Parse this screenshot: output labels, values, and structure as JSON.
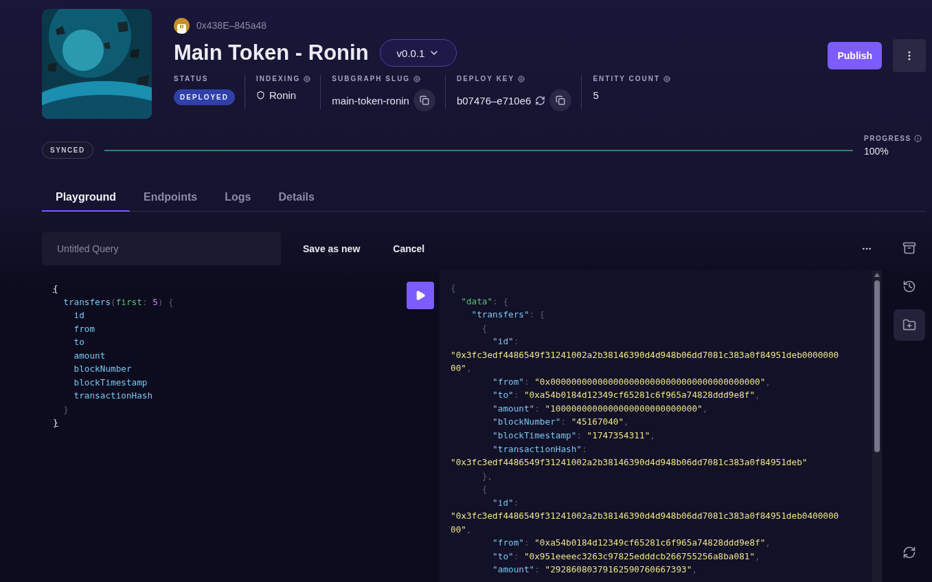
{
  "subgraph": {
    "owner": "0x438E–845a48",
    "title": "Main Token - Ronin",
    "version": "v0.0.1"
  },
  "stats": [
    {
      "kind": "badge",
      "label": "STATUS",
      "info": false,
      "value": "DEPLOYED"
    },
    {
      "kind": "network",
      "label": "INDEXING",
      "info": true,
      "value": "Ronin"
    },
    {
      "kind": "copy",
      "label": "SUBGRAPH SLUG",
      "info": true,
      "value": "main-token-ronin"
    },
    {
      "kind": "key",
      "label": "DEPLOY KEY",
      "info": true,
      "value": "b07476–e710e6"
    },
    {
      "kind": "text",
      "label": "ENTITY COUNT",
      "info": true,
      "value": "5"
    }
  ],
  "actions": {
    "publish": "Publish"
  },
  "sync": {
    "status": "SYNCED",
    "progress_label": "PROGRESS",
    "progress_value": "100%",
    "level": 1
  },
  "tabs": [
    {
      "label": "Playground",
      "selected": true
    },
    {
      "label": "Endpoints",
      "selected": false
    },
    {
      "label": "Logs",
      "selected": false
    },
    {
      "label": "Details",
      "selected": false
    }
  ],
  "query_bar": {
    "placeholder": "Untitled Query",
    "save": "Save as new",
    "cancel": "Cancel"
  },
  "query": [
    [
      {
        "kind": "match",
        "text": "{"
      }
    ],
    [
      {
        "kind": "field",
        "text": "  transfers"
      },
      {
        "kind": "punct",
        "text": "("
      },
      {
        "kind": "arg",
        "text": "first"
      },
      {
        "kind": "punct",
        "text": ": "
      },
      {
        "kind": "number",
        "text": "5"
      },
      {
        "kind": "punct",
        "text": ") {"
      }
    ],
    [
      {
        "kind": "field",
        "text": "    id"
      }
    ],
    [
      {
        "kind": "field",
        "text": "    from"
      }
    ],
    [
      {
        "kind": "field",
        "text": "    to"
      }
    ],
    [
      {
        "kind": "field",
        "text": "    amount"
      }
    ],
    [
      {
        "kind": "field",
        "text": "    blockNumber"
      }
    ],
    [
      {
        "kind": "field",
        "text": "    blockTimestamp"
      }
    ],
    [
      {
        "kind": "field",
        "text": "    transactionHash"
      }
    ],
    [
      {
        "kind": "punct",
        "text": "  }"
      }
    ],
    [
      {
        "kind": "match",
        "text": "}"
      }
    ]
  ],
  "response": [
    [
      {
        "kind": "punct",
        "text": "{"
      }
    ],
    [
      {
        "kind": "datakey",
        "text": "  \"data\""
      },
      {
        "kind": "punct",
        "text": ": {"
      }
    ],
    [
      {
        "kind": "field",
        "text": "    \"transfers\""
      },
      {
        "kind": "punct",
        "text": ": ["
      }
    ],
    [
      {
        "kind": "punct",
        "text": "      {"
      }
    ],
    [
      {
        "kind": "field",
        "text": "        \"id\""
      },
      {
        "kind": "punct",
        "text": ":"
      }
    ],
    [
      {
        "kind": "string",
        "text": "\"0x3fc3edf4486549f31241002a2b38146390d4d948b06dd7081c383a0f84951deb0000000"
      }
    ],
    [
      {
        "kind": "string",
        "text": "00\""
      },
      {
        "kind": "punct",
        "text": ","
      }
    ],
    [
      {
        "kind": "field",
        "text": "        \"from\""
      },
      {
        "kind": "punct",
        "text": ": "
      },
      {
        "kind": "string",
        "text": "\"0x0000000000000000000000000000000000000000\""
      },
      {
        "kind": "punct",
        "text": ","
      }
    ],
    [
      {
        "kind": "field",
        "text": "        \"to\""
      },
      {
        "kind": "punct",
        "text": ": "
      },
      {
        "kind": "string",
        "text": "\"0xa54b0184d12349cf65281c6f965a74828ddd9e8f\""
      },
      {
        "kind": "punct",
        "text": ","
      }
    ],
    [
      {
        "kind": "field",
        "text": "        \"amount\""
      },
      {
        "kind": "punct",
        "text": ": "
      },
      {
        "kind": "string",
        "text": "\"1000000000000000000000000000\""
      },
      {
        "kind": "punct",
        "text": ","
      }
    ],
    [
      {
        "kind": "field",
        "text": "        \"blockNumber\""
      },
      {
        "kind": "punct",
        "text": ": "
      },
      {
        "kind": "string",
        "text": "\"45167040\""
      },
      {
        "kind": "punct",
        "text": ","
      }
    ],
    [
      {
        "kind": "field",
        "text": "        \"blockTimestamp\""
      },
      {
        "kind": "punct",
        "text": ": "
      },
      {
        "kind": "string",
        "text": "\"1747354311\""
      },
      {
        "kind": "punct",
        "text": ","
      }
    ],
    [
      {
        "kind": "field",
        "text": "        \"transactionHash\""
      },
      {
        "kind": "punct",
        "text": ":"
      }
    ],
    [
      {
        "kind": "string",
        "text": "\"0x3fc3edf4486549f31241002a2b38146390d4d948b06dd7081c383a0f84951deb\""
      }
    ],
    [
      {
        "kind": "punct",
        "text": "      },"
      }
    ],
    [
      {
        "kind": "punct",
        "text": "      {"
      }
    ],
    [
      {
        "kind": "field",
        "text": "        \"id\""
      },
      {
        "kind": "punct",
        "text": ":"
      }
    ],
    [
      {
        "kind": "string",
        "text": "\"0x3fc3edf4486549f31241002a2b38146390d4d948b06dd7081c383a0f84951deb0400000"
      }
    ],
    [
      {
        "kind": "string",
        "text": "00\""
      },
      {
        "kind": "punct",
        "text": ","
      }
    ],
    [
      {
        "kind": "field",
        "text": "        \"from\""
      },
      {
        "kind": "punct",
        "text": ": "
      },
      {
        "kind": "string",
        "text": "\"0xa54b0184d12349cf65281c6f965a74828ddd9e8f\""
      },
      {
        "kind": "punct",
        "text": ","
      }
    ],
    [
      {
        "kind": "field",
        "text": "        \"to\""
      },
      {
        "kind": "punct",
        "text": ": "
      },
      {
        "kind": "string",
        "text": "\"0x951eeeec3263c97825edddcb266755256a8ba081\""
      },
      {
        "kind": "punct",
        "text": ","
      }
    ],
    [
      {
        "kind": "field",
        "text": "        \"amount\""
      },
      {
        "kind": "punct",
        "text": ": "
      },
      {
        "kind": "string",
        "text": "\"29286080379162590760667393\""
      },
      {
        "kind": "punct",
        "text": ","
      }
    ]
  ]
}
